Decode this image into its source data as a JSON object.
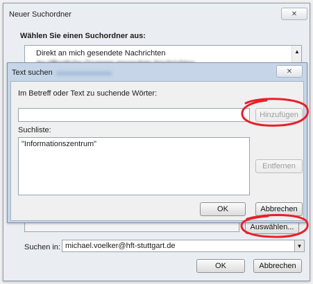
{
  "outer_dialog": {
    "title": "Neuer Suchordner",
    "section_heading": "Wählen Sie einen Suchordner aus:",
    "list_items": [
      "Direkt an mich gesendete Nachrichten",
      "An öffentliche Gruppen gesendete Nachrichten"
    ],
    "choose_button": "Auswählen...",
    "search_in_label": "Suchen in:",
    "search_in_value": "michael.voelker@hft-stuttgart.de",
    "ok_button": "OK",
    "cancel_button": "Abbrechen"
  },
  "inner_dialog": {
    "title": "Text suchen",
    "words_label": "Im Betreff oder Text zu suchende Wörter:",
    "words_input_value": "",
    "add_button": "Hinzufügen",
    "search_list_label": "Suchliste:",
    "search_list_items": [
      "\"Informationszentrum\""
    ],
    "remove_button": "Entfernen",
    "ok_button": "OK",
    "cancel_button": "Abbrechen"
  },
  "close_glyph": "☒",
  "annotation_color": "#e8202a",
  "icons": {
    "close": "close-icon",
    "scroll_up": "scroll-up-arrow-icon",
    "dropdown": "chevron-down-icon"
  }
}
